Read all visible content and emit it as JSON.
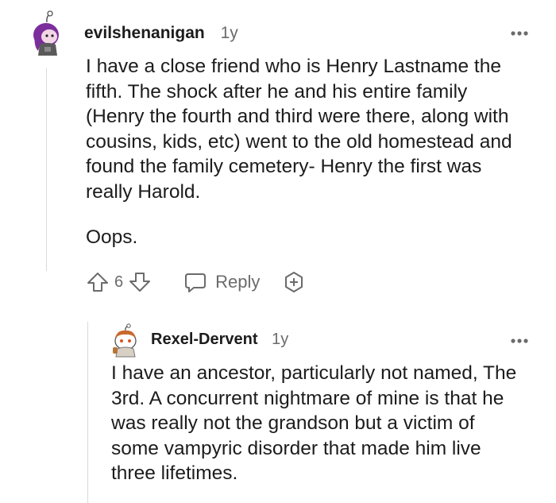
{
  "comments": [
    {
      "author": "evilshenanigan",
      "age": "1y",
      "body": "I have a close friend who is Henry Lastname the fifth. The shock after he and his entire family (Henry the fourth and third were there, along with cousins, kids, etc) went to the old homestead and found the family cemetery- Henry the first was really Harold.",
      "body2": "Oops.",
      "votes": "6",
      "reply_label": "Reply"
    },
    {
      "author": "Rexel-Dervent",
      "age": "1y",
      "body": "I have an ancestor, particularly not named, The 3rd. A concurrent nightmare of mine is that he was really not the grandson but a victim of some vampyric disorder that made him live three lifetimes."
    }
  ],
  "icons": {
    "more": "more-options-icon",
    "upvote": "upvote-arrow-icon",
    "downvote": "downvote-arrow-icon",
    "reply": "speech-bubble-icon",
    "award": "award-plus-icon"
  },
  "colors": {
    "text": "#1c1c1c",
    "muted": "#6b6b6b",
    "thread_line": "#d9d9d9"
  }
}
